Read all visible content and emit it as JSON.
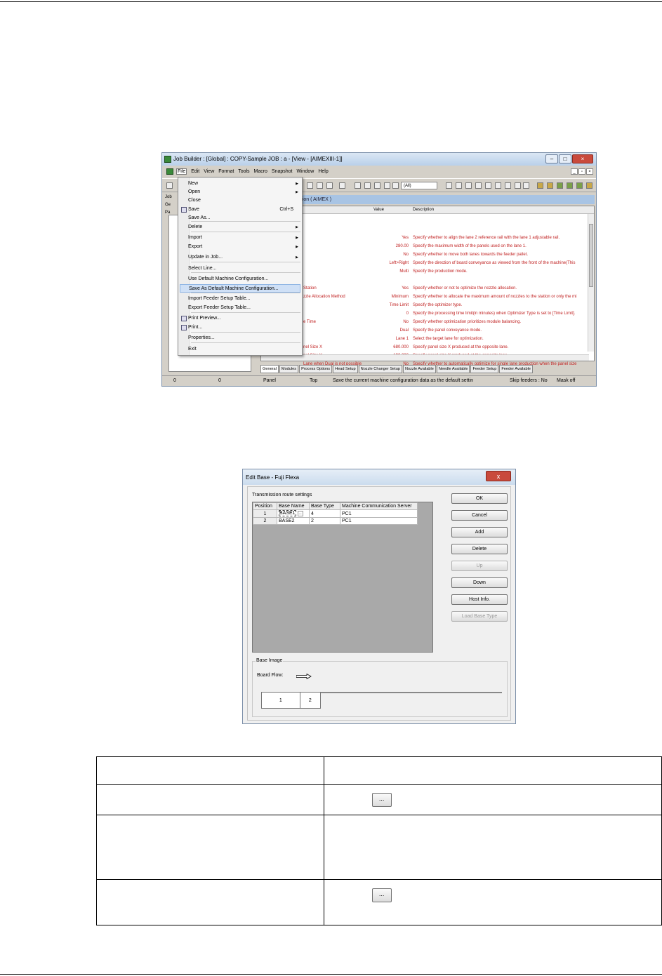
{
  "job_builder": {
    "title": "Job Builder : [Global] : COPY-Sample JOB : a - [View - [AIMEXIII-1]]",
    "menubar": [
      "File",
      "Edit",
      "View",
      "Format",
      "Tools",
      "Macro",
      "Snapshot",
      "Window",
      "Help"
    ],
    "toolbar_combo": "(All)",
    "left_stubs": [
      "Job",
      "Ge",
      "Pa"
    ],
    "grid_title": "ation ( AIMEX )",
    "columns": [
      "Value",
      "Description"
    ],
    "rows": [
      {
        "name": "",
        "value": "Yes",
        "desc": "Specify whether to align the lane 2 reference rail with the lane 1 adjustable rail."
      },
      {
        "name": "",
        "value": "280.00",
        "desc": "Specify the maximum width of the panels used on the lane 1."
      },
      {
        "name": "",
        "value": "No",
        "desc": "Specify whether to move both lanes towards the feeder pallet."
      },
      {
        "name": "",
        "value": "Left>Right",
        "desc": "Specify the direction of board conveyance as viewed from the front of the machine(This"
      },
      {
        "name": "",
        "value": "Multi",
        "desc": "Specify the production mode."
      },
      {
        "name": "Station",
        "value": "Yes",
        "desc": "Specify whether or not to optimize the nozzle allocation."
      },
      {
        "name": "zzle Allocation Method",
        "value": "Minimum",
        "desc": "Specify whether to allocate the maximum amount of nozzles to the station or only the mi"
      },
      {
        "name": "",
        "value": "Time Limit",
        "desc": "Specify the optimizer type."
      },
      {
        "name": "",
        "value": "0",
        "desc": "Specify the processing time limit(in minutes) when Optimizer Type is set to [Time Limit]."
      },
      {
        "name": "e Time",
        "value": "No",
        "desc": "Specify whether optimization prioritizes module balancing."
      },
      {
        "name": "",
        "value": "Dual",
        "desc": "Specify the panel conveyance mode."
      },
      {
        "name": "",
        "value": "Lane 1",
        "desc": "Select the target lane for optimization."
      },
      {
        "name": "nel Size X",
        "value": "680.000",
        "desc": "Specify panel size X produced at the opposite lane."
      },
      {
        "name": "nel Size Y",
        "value": "190.000",
        "desc": "Specify panel size Y produced at the opposite lane."
      },
      {
        "name": "Lane when Dual is not possible",
        "value": "No",
        "desc": "Specify whether to automatically optimize for single lane production when the panel size"
      }
    ],
    "tabs": [
      "General",
      "Modules",
      "Process Options",
      "Head Setup",
      "Nozzle Changer Setup",
      "Nozzle Available",
      "Needle Available",
      "Feeder Setup",
      "Feeder Available"
    ],
    "status": [
      "0",
      "0",
      "Panel",
      "Top",
      "Save the current machine configuration data as the default settin",
      "Skip feeders : No",
      "Mask off"
    ],
    "file_menu": [
      {
        "label": "New",
        "submenu": true
      },
      {
        "label": "Open",
        "submenu": true
      },
      {
        "label": "Close"
      },
      {
        "label": "Save",
        "shortcut": "Ctrl+S",
        "icon": "save-icon"
      },
      {
        "label": "Save As..."
      },
      {
        "label": "Delete",
        "submenu": true
      },
      {
        "label": "Import",
        "submenu": true
      },
      {
        "label": "Export",
        "submenu": true
      },
      {
        "label": "Update in Job...",
        "submenu": true
      },
      {
        "label": "Select Line..."
      },
      {
        "label": "Use Default Machine Configuration..."
      },
      {
        "label": "Save As Default Machine Configuration...",
        "highlighted": true
      },
      {
        "label": "Import Feeder Setup Table..."
      },
      {
        "label": "Export Feeder Setup Table..."
      },
      {
        "label": "Print Preview...",
        "icon": "print-preview-icon"
      },
      {
        "label": "Print...",
        "icon": "printer-icon"
      },
      {
        "label": "Properties..."
      },
      {
        "label": "Exit"
      }
    ]
  },
  "edit_base": {
    "title": "Edit Base - Fuji Flexa",
    "close": "x",
    "group_label": "Transmission route settings",
    "columns": [
      "Position",
      "Base Name",
      "Base Type",
      "Machine Communication Server"
    ],
    "rows": [
      {
        "position": "1",
        "name": "BASE1",
        "ellipsis": "...",
        "type": "4",
        "server": "PC1"
      },
      {
        "position": "2",
        "name": "BASE2",
        "ellipsis": "",
        "type": "2",
        "server": "PC1"
      }
    ],
    "buttons": [
      {
        "label": "OK",
        "enabled": true
      },
      {
        "label": "Cancel",
        "enabled": true
      },
      {
        "label": "Add",
        "enabled": true
      },
      {
        "label": "Delete",
        "enabled": true
      },
      {
        "label": "Up",
        "enabled": false
      },
      {
        "label": "Down",
        "enabled": true
      },
      {
        "label": "Host Info.",
        "enabled": true
      },
      {
        "label": "Load Base Type",
        "enabled": false
      }
    ],
    "base_image_label": "Base Image",
    "board_flow_label": "Board Flow:",
    "base_boxes": [
      "1",
      "2"
    ]
  },
  "doc_table": {
    "buttons": [
      "...",
      "..."
    ]
  }
}
